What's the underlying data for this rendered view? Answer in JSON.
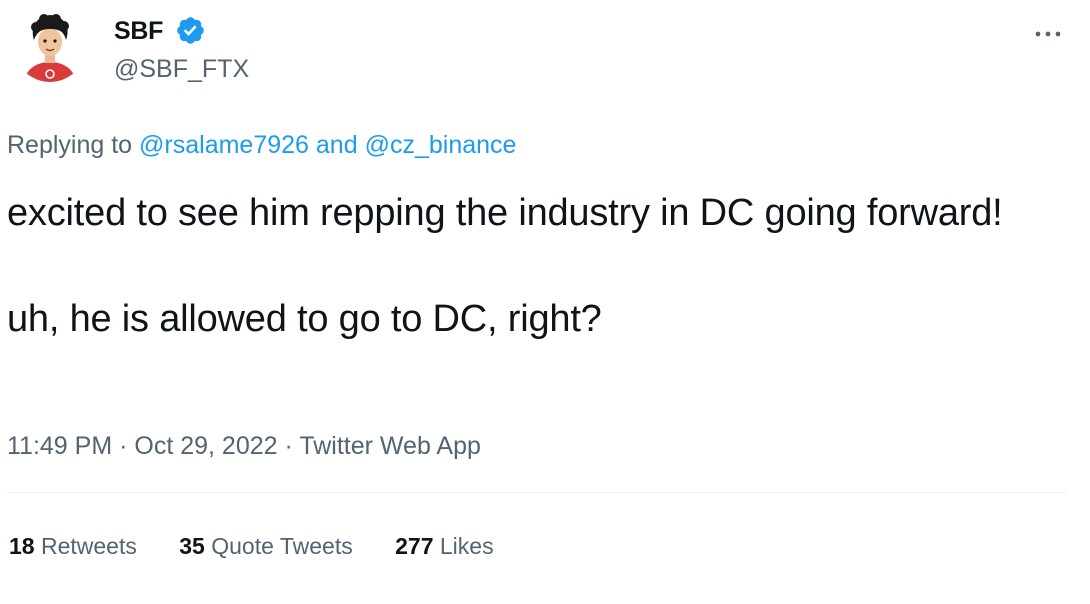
{
  "user": {
    "display_name": "SBF",
    "handle": "@SBF_FTX",
    "verified": true,
    "avatar_icon": "profile-avatar-cartoon",
    "verified_color": "#1d9bf0"
  },
  "reply": {
    "prefix": "Replying to",
    "mention1": "@rsalame7926",
    "joiner": "and",
    "mention2": "@cz_binance"
  },
  "tweet": {
    "paragraph1": "excited to see him repping the industry in DC going forward!",
    "paragraph2": "uh, he is allowed to go to DC, right?"
  },
  "meta": {
    "time": "11:49 PM",
    "sep": "·",
    "date": "Oct 29, 2022",
    "source": "Twitter Web App"
  },
  "stats": {
    "retweets_count": "18",
    "retweets_label": "Retweets",
    "quotes_count": "35",
    "quotes_label": "Quote Tweets",
    "likes_count": "277",
    "likes_label": "Likes"
  },
  "colors": {
    "link": "#1d9bf0",
    "secondary_text": "#536471",
    "primary_text": "#0f1419"
  }
}
